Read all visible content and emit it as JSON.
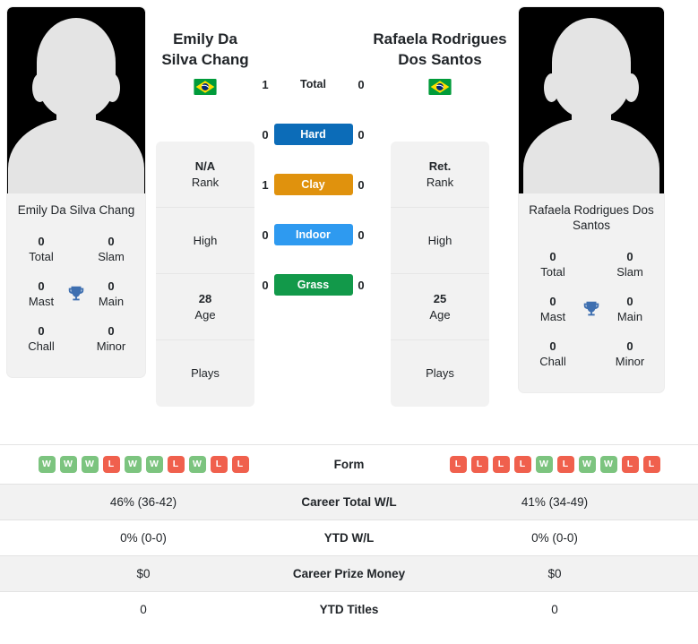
{
  "players": {
    "left": {
      "display_name": "Emily Da\nSilva Chang",
      "name_line1": "Emily Da",
      "name_line2": "Silva Chang",
      "card_name": "Emily Da Silva Chang",
      "country": "Brazil",
      "flag": "br",
      "titles": [
        {
          "value": "0",
          "label": "Total"
        },
        {
          "value": "0",
          "label": "Slam"
        },
        {
          "value": "0",
          "label": "Mast"
        },
        {
          "value": "0",
          "label": "Main"
        },
        {
          "value": "0",
          "label": "Chall"
        },
        {
          "value": "0",
          "label": "Minor"
        }
      ],
      "info": [
        {
          "value": "N/A",
          "label": "Rank"
        },
        {
          "value": "",
          "label": "High"
        },
        {
          "value": "28",
          "label": "Age"
        },
        {
          "value": "",
          "label": "Plays"
        }
      ],
      "form": [
        "W",
        "W",
        "W",
        "L",
        "W",
        "W",
        "L",
        "W",
        "L",
        "L"
      ],
      "career_total_wl": "46% (36-42)",
      "ytd_wl": "0% (0-0)",
      "career_prize_money": "$0",
      "ytd_titles": "0"
    },
    "right": {
      "display_name": "Rafaela Rodrigues\nDos Santos",
      "name_line1": "Rafaela Rodrigues",
      "name_line2": "Dos Santos",
      "card_name": "Rafaela Rodrigues Dos Santos",
      "country": "Brazil",
      "flag": "br",
      "titles": [
        {
          "value": "0",
          "label": "Total"
        },
        {
          "value": "0",
          "label": "Slam"
        },
        {
          "value": "0",
          "label": "Mast"
        },
        {
          "value": "0",
          "label": "Main"
        },
        {
          "value": "0",
          "label": "Chall"
        },
        {
          "value": "0",
          "label": "Minor"
        }
      ],
      "info": [
        {
          "value": "Ret.",
          "label": "Rank"
        },
        {
          "value": "",
          "label": "High"
        },
        {
          "value": "25",
          "label": "Age"
        },
        {
          "value": "",
          "label": "Plays"
        }
      ],
      "form": [
        "L",
        "L",
        "L",
        "L",
        "W",
        "L",
        "W",
        "W",
        "L",
        "L"
      ],
      "career_total_wl": "41% (34-49)",
      "ytd_wl": "0% (0-0)",
      "career_prize_money": "$0",
      "ytd_titles": "0"
    }
  },
  "h2h": [
    {
      "label": "Total",
      "left": "1",
      "right": "0",
      "color": "",
      "style": "plain"
    },
    {
      "label": "Hard",
      "left": "0",
      "right": "0",
      "color": "#0c6cb8",
      "style": "chip"
    },
    {
      "label": "Clay",
      "left": "1",
      "right": "0",
      "color": "#e0920d",
      "style": "chip"
    },
    {
      "label": "Indoor",
      "left": "0",
      "right": "0",
      "color": "#2e9af0",
      "style": "chip"
    },
    {
      "label": "Grass",
      "left": "0",
      "right": "0",
      "color": "#12994a",
      "style": "chip"
    }
  ],
  "table_rows": [
    {
      "label": "Form",
      "type": "form",
      "shaded": false
    },
    {
      "label": "Career Total W/L",
      "type": "text",
      "shaded": true,
      "left": "46% (36-42)",
      "right": "41% (34-49)"
    },
    {
      "label": "YTD W/L",
      "type": "text",
      "shaded": false,
      "left": "0% (0-0)",
      "right": "0% (0-0)"
    },
    {
      "label": "Career Prize Money",
      "type": "text",
      "shaded": true,
      "left": "$0",
      "right": "$0"
    },
    {
      "label": "YTD Titles",
      "type": "text",
      "shaded": false,
      "left": "0",
      "right": "0"
    }
  ],
  "colors": {
    "hard": "#0c6cb8",
    "clay": "#e0920d",
    "indoor": "#2e9af0",
    "grass": "#12994a",
    "win": "#7cc47f",
    "loss": "#f0604d",
    "trophy": "#3e6fb0",
    "card_bg": "#f2f2f2"
  }
}
